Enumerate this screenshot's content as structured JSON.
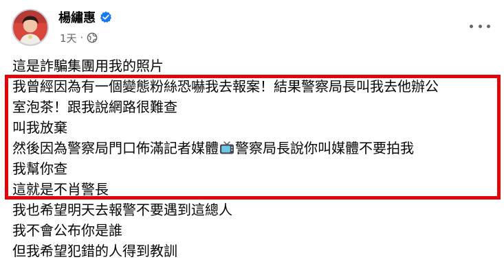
{
  "post": {
    "author": "楊繡惠",
    "time": "1天",
    "dot": "·",
    "lines_before": [
      "這是詐騙集團用我的照片"
    ],
    "highlighted": {
      "line1": "我曾經因為有一個變態粉絲恐嚇我去報案！結果警察局長叫我去他辦公",
      "line2": "室泡茶！跟我說網路很難查",
      "line3": "叫我放棄",
      "line4_a": "然後因為警察局門口佈滿記者媒體",
      "line4_b": "警察局長說你叫媒體不要拍我",
      "line5": "我幫你查",
      "line6": "這就是不肖警長"
    },
    "lines_after": [
      "我也希望明天去報警不要遇到這總人",
      "我不會公布你是誰",
      "但我希望犯錯的人得到教訓"
    ]
  },
  "icons": {
    "verified": "verified-badge-icon",
    "audience": "globe-icon",
    "more": "more-options-icon",
    "inline_emoji": "television-icon"
  },
  "colors": {
    "highlight": "#e4050b",
    "verified": "#1877f2",
    "secondary_text": "#65676b"
  }
}
